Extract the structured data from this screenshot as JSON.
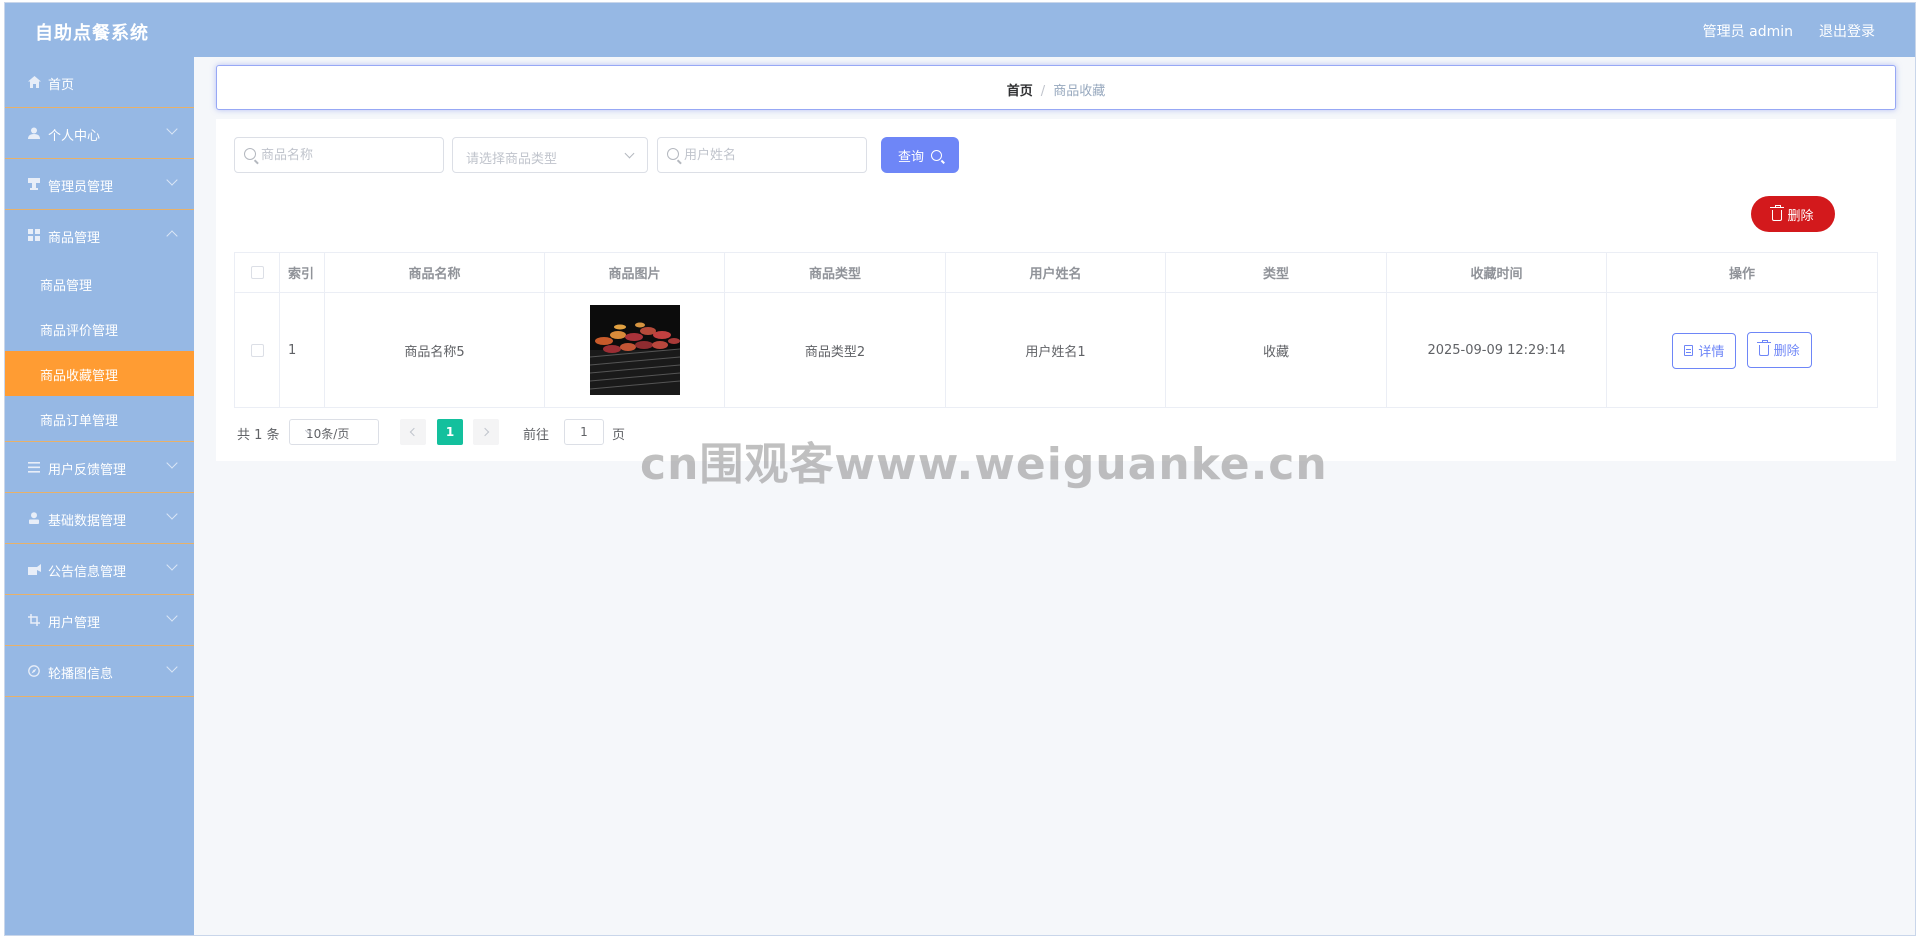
{
  "header": {
    "title": "自助点餐系统",
    "admin_label": "管理员 admin",
    "logout_label": "退出登录"
  },
  "sidebar": {
    "items": [
      {
        "label": "首页",
        "icon": "home-icon",
        "expandable": false
      },
      {
        "label": "个人中心",
        "icon": "user-icon",
        "expandable": true
      },
      {
        "label": "管理员管理",
        "icon": "stamp-icon",
        "expandable": true
      },
      {
        "label": "商品管理",
        "icon": "grid-icon",
        "expandable": true,
        "expanded": true,
        "children": [
          {
            "label": "商品管理"
          },
          {
            "label": "商品评价管理"
          },
          {
            "label": "商品收藏管理",
            "active": true
          },
          {
            "label": "商品订单管理"
          }
        ]
      },
      {
        "label": "用户反馈管理",
        "icon": "menu-lines-icon",
        "expandable": true
      },
      {
        "label": "基础数据管理",
        "icon": "person-icon",
        "expandable": true
      },
      {
        "label": "公告信息管理",
        "icon": "megaphone-icon",
        "expandable": true
      },
      {
        "label": "用户管理",
        "icon": "crop-icon",
        "expandable": true
      },
      {
        "label": "轮播图信息",
        "icon": "compass-icon",
        "expandable": true
      }
    ]
  },
  "breadcrumb": {
    "home": "首页",
    "separator": "/",
    "current": "商品收藏"
  },
  "search": {
    "name_placeholder": "商品名称",
    "type_placeholder": "请选择商品类型",
    "user_placeholder": "用户姓名",
    "query_label": "查询"
  },
  "toolbar": {
    "delete_label": "删除"
  },
  "table": {
    "columns": [
      "索引",
      "商品名称",
      "商品图片",
      "商品类型",
      "用户姓名",
      "类型",
      "收藏时间",
      "操作"
    ],
    "rows": [
      {
        "index": "1",
        "name": "商品名称5",
        "type": "商品类型2",
        "user": "用户姓名1",
        "kind": "收藏",
        "time": "2025-09-09 12:29:14",
        "detail_label": "详情",
        "delete_label": "删除"
      }
    ]
  },
  "pagination": {
    "total": "共 1 条",
    "page_size": "10条/页",
    "current_page": "1",
    "goto_label": "前往",
    "goto_value": "1",
    "page_unit": "页"
  },
  "watermark": "cn围观客www.weiguanke.cn",
  "colors": {
    "header_bg": "#96b8e4",
    "active_menu": "#ff9c33",
    "primary": "#6e86f7",
    "danger": "#d3191c",
    "page_active": "#13c09d"
  }
}
